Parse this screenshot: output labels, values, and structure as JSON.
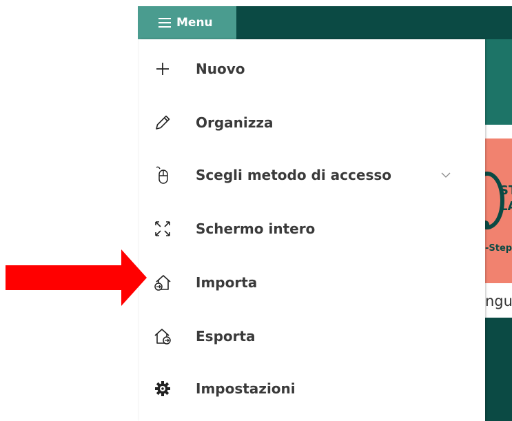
{
  "topbar": {
    "menu_label": "Menu",
    "colors": {
      "bar": "#0b4a44",
      "menu_button": "#4a9c8f"
    }
  },
  "menu": {
    "items": [
      {
        "label": "Nuovo",
        "icon": "plus-icon"
      },
      {
        "label": "Organizza",
        "icon": "pencil-icon"
      },
      {
        "label": "Scegli metodo di accesso",
        "icon": "mouse-icon",
        "expandable": true
      },
      {
        "label": "Schermo intero",
        "icon": "fullscreen-icon"
      },
      {
        "label": "Importa",
        "icon": "import-home-icon"
      },
      {
        "label": "Esporta",
        "icon": "export-home-icon"
      },
      {
        "label": "Impostazioni",
        "icon": "gear-icon"
      }
    ]
  },
  "background": {
    "banner_text_1": "ST",
    "banner_text_2": "LA",
    "banner_text_3": "-Step",
    "partial_text": "ngu",
    "colors": {
      "teal": "#1d7467",
      "salmon": "#f1826f",
      "dark": "#0b4a44"
    }
  },
  "annotation": {
    "arrow_color": "#ff0000",
    "points_to": "Importa"
  }
}
